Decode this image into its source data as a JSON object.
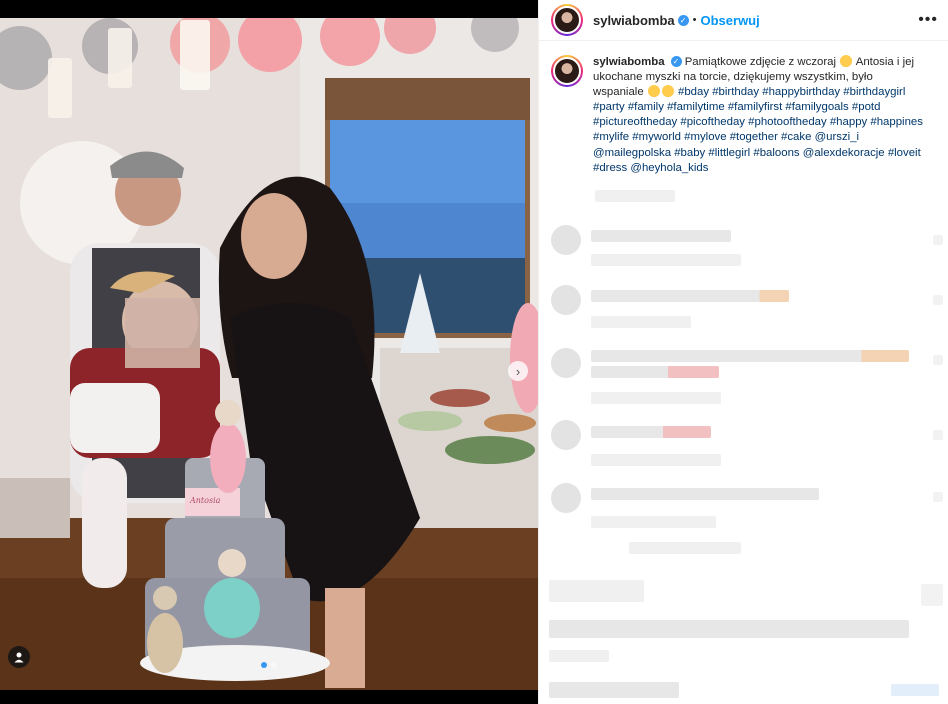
{
  "post": {
    "username": "sylwiabomba",
    "follow_label": "Obserwuj",
    "more_label": "•••",
    "bullet": "•",
    "verified_mark": "✓"
  },
  "photo": {
    "cake_sign": "Antosia",
    "next_arrow": "›",
    "user_tag_icon": "person-icon"
  },
  "caption": {
    "username": "sylwiabomba",
    "text_part1": "Pamiątkowe zdjęcie z wczoraj",
    "text_part2": "Antosia i jej ukochane myszki na torcie, dziękujemy wszystkim, było wspaniale",
    "hashtags_line": "#bday #birthday #happybirthday #birthdaygirl #party #family #familytime #familyfirst #familygoals #potd #pictureoftheday #picoftheday #photooftheday #happy #happines #mylife #myworld #mylove #together #cake",
    "mention1": "@urszi_i",
    "mention2": "@mailegpolska",
    "hashtags_line2": "#baby #littlegirl #baloons",
    "mention3": "@alexdekoracje",
    "hashtags_line3": "#loveit #dress",
    "mention4": "@heyhola_kids"
  },
  "colors": {
    "accent": "#0095f6",
    "tag": "#00376b",
    "verified": "#3897f0",
    "text": "#262626"
  }
}
